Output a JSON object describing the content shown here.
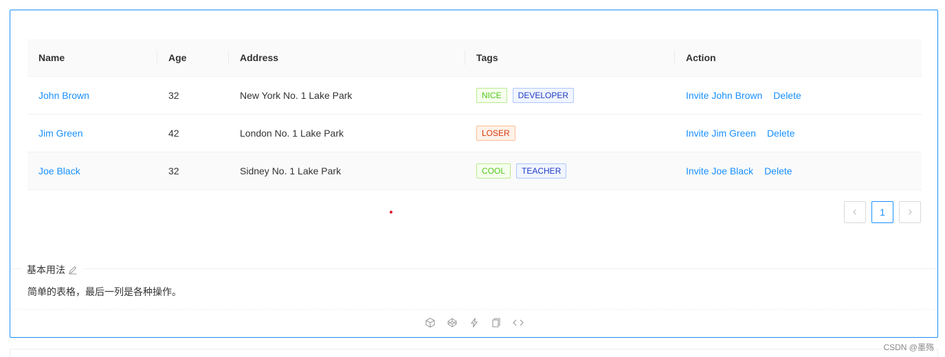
{
  "table": {
    "columns": [
      "Name",
      "Age",
      "Address",
      "Tags",
      "Action"
    ],
    "rows": [
      {
        "name": "John Brown",
        "age": "32",
        "address": "New York No. 1 Lake Park",
        "tags": [
          "NICE",
          "DEVELOPER"
        ],
        "invite": "Invite John Brown",
        "delete": "Delete"
      },
      {
        "name": "Jim Green",
        "age": "42",
        "address": "London No. 1 Lake Park",
        "tags": [
          "LOSER"
        ],
        "invite": "Invite Jim Green",
        "delete": "Delete"
      },
      {
        "name": "Joe Black",
        "age": "32",
        "address": "Sidney No. 1 Lake Park",
        "tags": [
          "COOL",
          "TEACHER"
        ],
        "invite": "Invite Joe Black",
        "delete": "Delete"
      }
    ]
  },
  "pagination": {
    "prev_icon": "chevron-left-icon",
    "current": "1",
    "next_icon": "chevron-right-icon"
  },
  "demo": {
    "title": "基本用法",
    "description": "简单的表格，最后一列是各种操作。",
    "action_icons": [
      "codesandbox-icon",
      "codepen-icon",
      "stackblitz-icon",
      "copy-icon",
      "code-icon"
    ]
  },
  "watermark": "CSDN @墨殇",
  "colors": {
    "primary": "#1890ff",
    "tag_green": "#52c41a",
    "tag_geekblue": "#1d39c4",
    "tag_volcano": "#d4380d"
  }
}
